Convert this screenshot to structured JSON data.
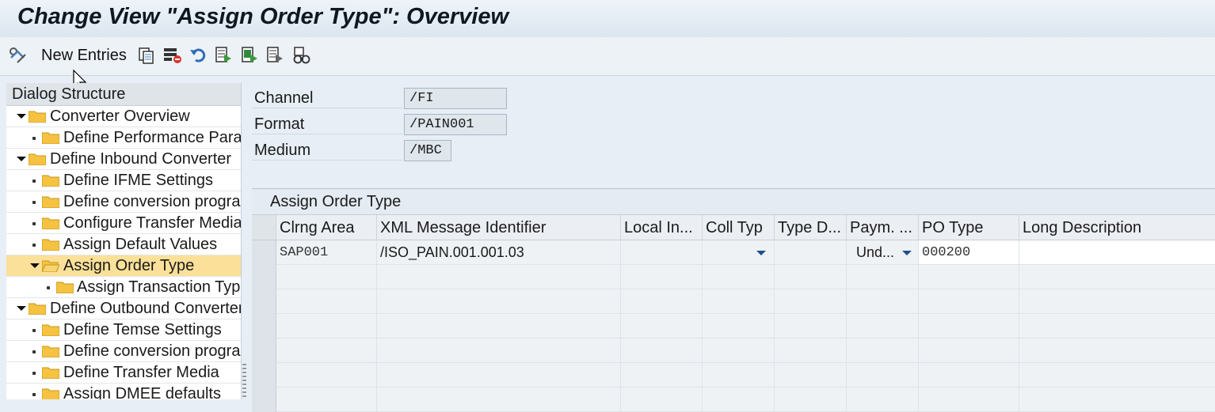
{
  "window": {
    "title": "Change View \"Assign Order Type\": Overview"
  },
  "toolbar": {
    "new_entries_label": "New Entries",
    "icons": [
      "display-change-icon",
      "copy-icon",
      "delete-icon",
      "undo-icon",
      "select-all-icon",
      "select-block-icon",
      "deselect-all-icon",
      "print-icon"
    ]
  },
  "dialog_structure": {
    "header": "Dialog Structure",
    "items": [
      {
        "label": "Converter Overview",
        "level": 0,
        "expanded": true
      },
      {
        "label": "Define Performance Parar",
        "level": 1
      },
      {
        "label": "Define Inbound Converter",
        "level": 0,
        "expanded": true
      },
      {
        "label": "Define IFME Settings",
        "level": 1
      },
      {
        "label": "Define conversion progra",
        "level": 1
      },
      {
        "label": "Configure Transfer Media",
        "level": 1
      },
      {
        "label": "Assign Default Values",
        "level": 1
      },
      {
        "label": "Assign Order Type",
        "level": 1,
        "expanded": true,
        "selected": true
      },
      {
        "label": "Assign Transaction Typ",
        "level": 2
      },
      {
        "label": "Define Outbound Converter",
        "level": 0,
        "expanded": true
      },
      {
        "label": "Define Temse Settings",
        "level": 1
      },
      {
        "label": "Define conversion progra",
        "level": 1
      },
      {
        "label": "Define Transfer Media",
        "level": 1
      },
      {
        "label": "Assign DMEE defaults",
        "level": 1
      }
    ]
  },
  "fields": [
    {
      "label": "Channel",
      "value": "/FI"
    },
    {
      "label": "Format",
      "value": "/PAIN001"
    },
    {
      "label": "Medium",
      "value": "/MBC"
    }
  ],
  "table": {
    "title": "Assign Order Type",
    "columns": [
      "Clrng Area",
      "XML Message Identifier",
      "Local In...",
      "Coll Typ",
      "Type D...",
      "Paym. ...",
      "PO Type",
      "Long Description"
    ],
    "rows": [
      {
        "clrng_area": "SAP001",
        "xml_msg_id": "/ISO_PAIN.001.001.03",
        "local_in": "",
        "coll_typ": "",
        "type_d": "",
        "paym": "Und...",
        "po_type": "000200",
        "long_desc": ""
      }
    ]
  },
  "colors": {
    "folder": "#f5c242",
    "selected_row": "#fbe099",
    "dropdown_arrow": "#1f4f8a"
  }
}
